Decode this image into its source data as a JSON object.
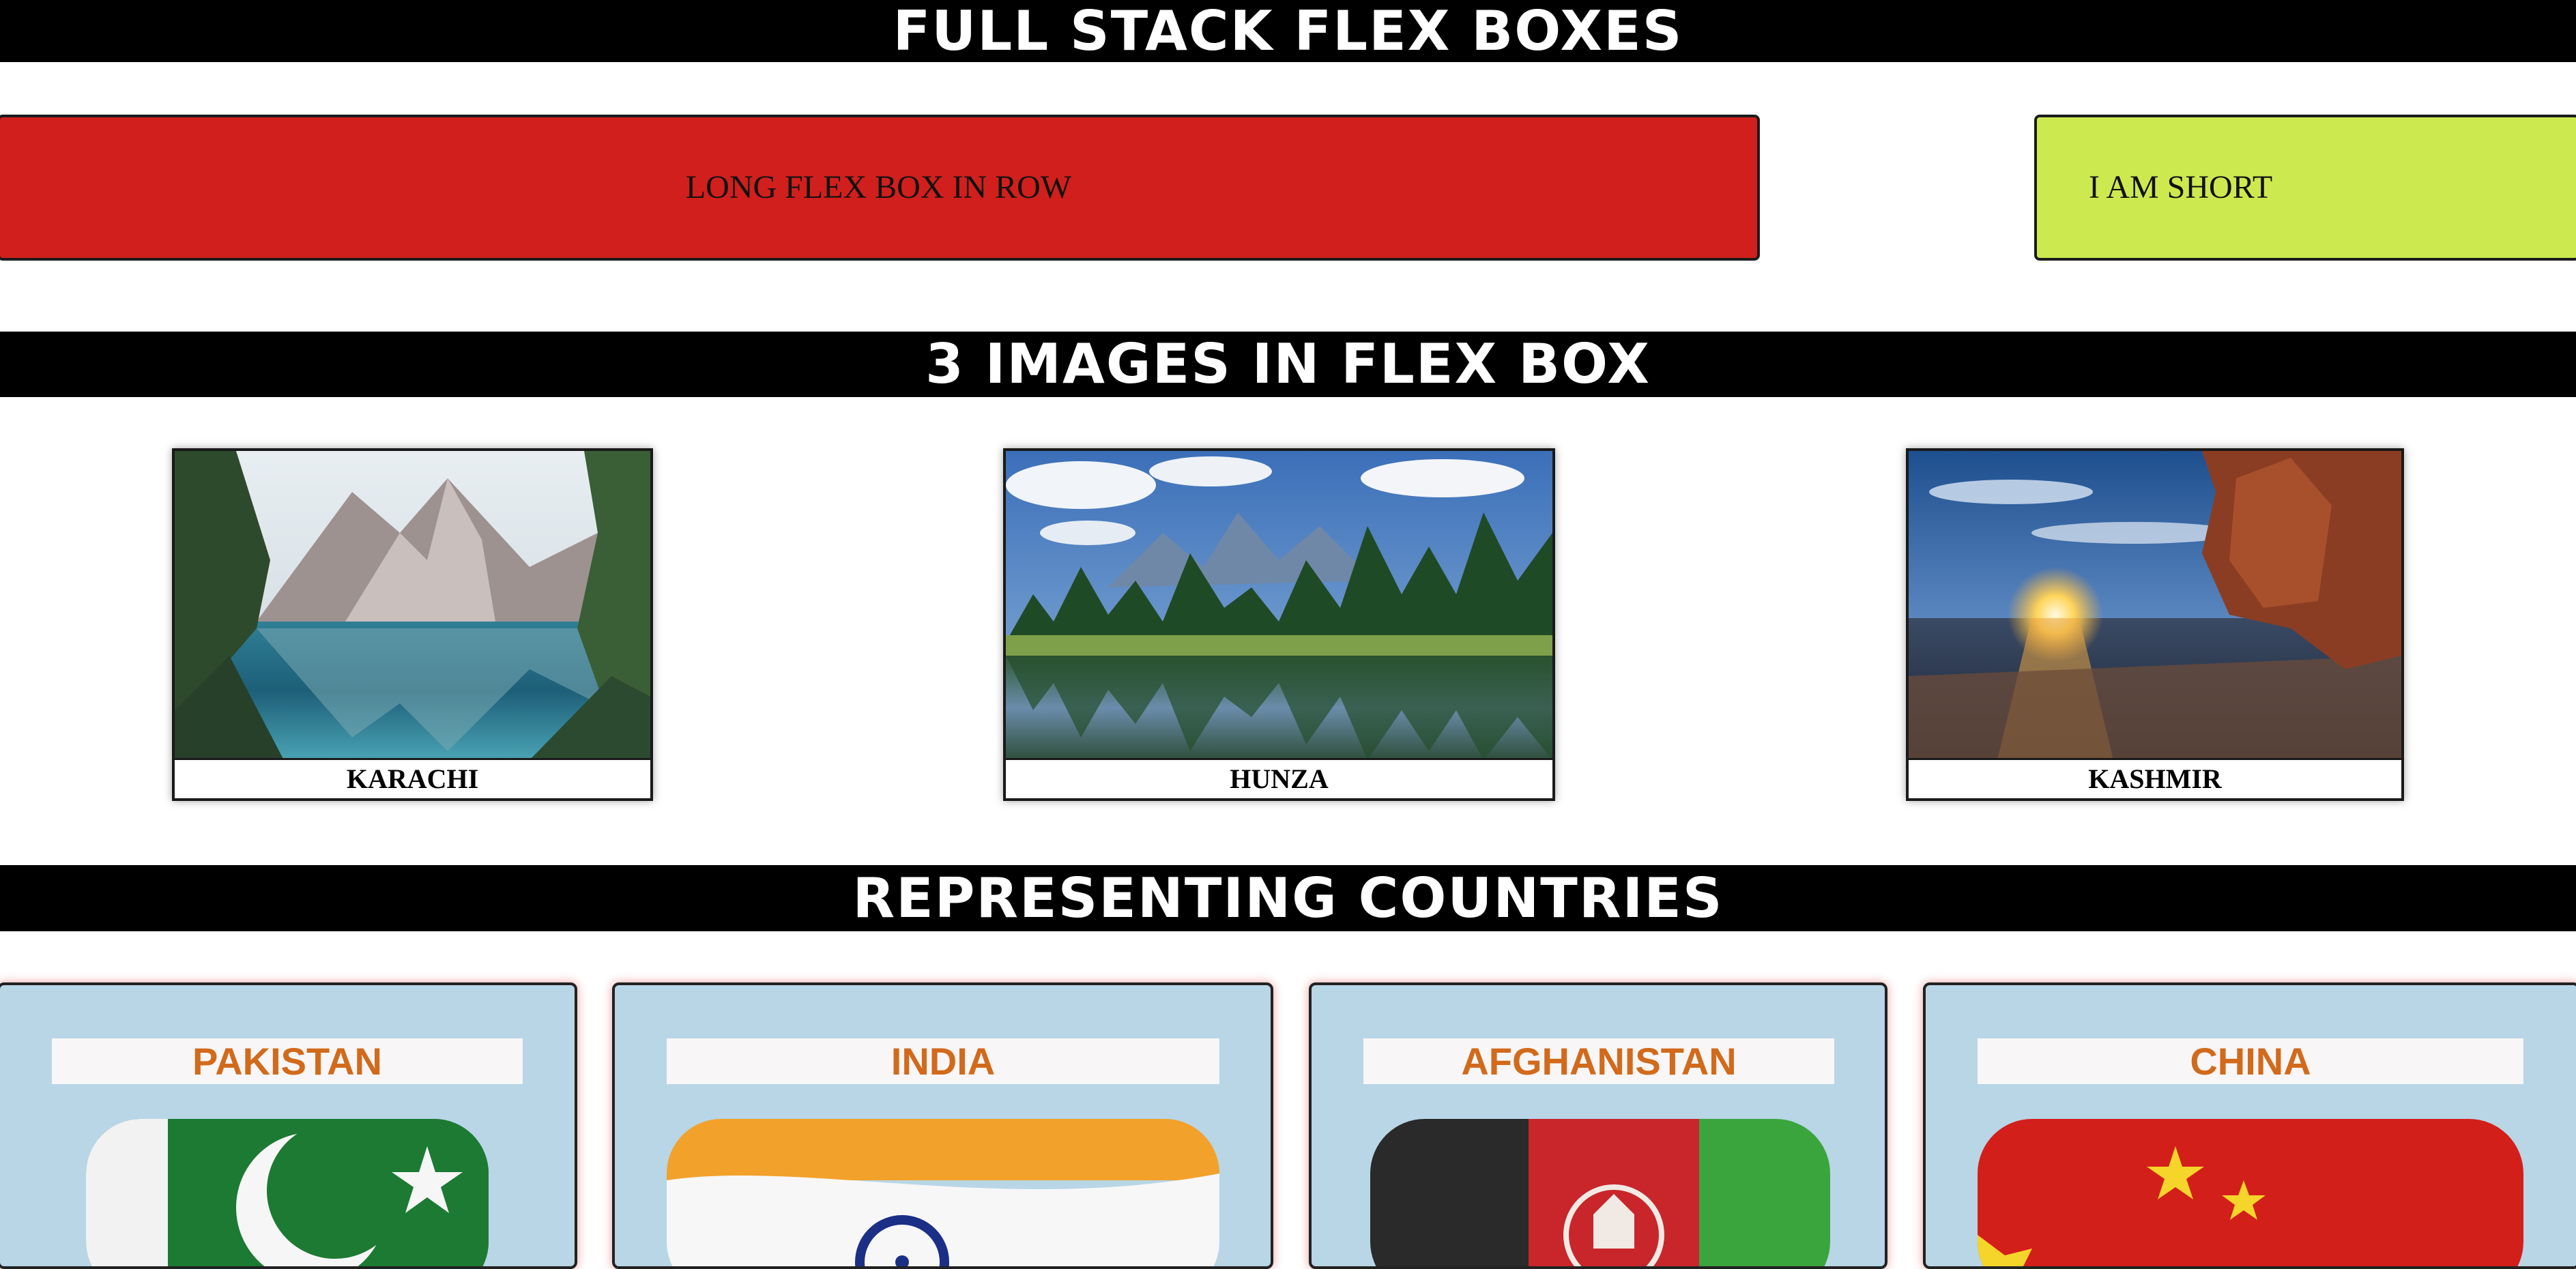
{
  "headers": {
    "flex_title": "FULL STACK FLEX BOXES",
    "images_title": "3 IMAGES IN FLEX BOX",
    "countries_title": "REPRESENTING COUNTRIES"
  },
  "flex_row": {
    "long_box": {
      "label": "LONG FLEX BOX IN ROW",
      "color": "#d11f1d"
    },
    "short_box": {
      "label": "I AM SHORT",
      "color": "#ccea4f"
    }
  },
  "gallery": {
    "items": [
      {
        "caption": "KARACHI",
        "image": "mountain-lake-photo"
      },
      {
        "caption": "HUNZA",
        "image": "forest-lake-photo"
      },
      {
        "caption": "KASHMIR",
        "image": "sunset-beach-photo"
      }
    ]
  },
  "countries": {
    "items": [
      {
        "name": "PAKISTAN",
        "flag": "pakistan-flag"
      },
      {
        "name": "INDIA",
        "flag": "india-flag"
      },
      {
        "name": "AFGHANISTAN",
        "flag": "afghanistan-flag"
      },
      {
        "name": "CHINA",
        "flag": "china-flag"
      }
    ]
  },
  "colors": {
    "band_bg": "#000000",
    "card_bg": "#b8d6e6",
    "country_name_text": "#d26a1c"
  }
}
